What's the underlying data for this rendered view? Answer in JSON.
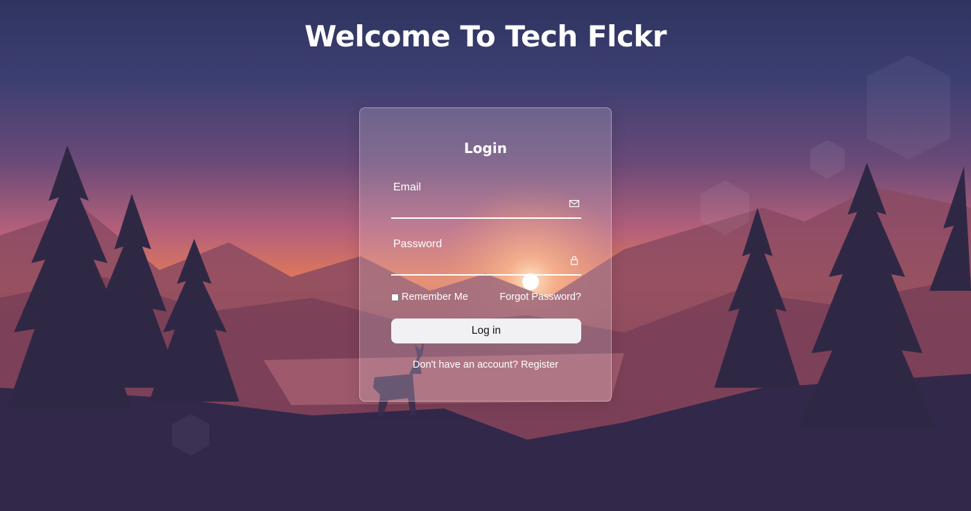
{
  "page": {
    "title": "Welcome To Tech Flckr"
  },
  "login_card": {
    "title": "Login",
    "email": {
      "label": "Email",
      "value": "",
      "icon": "mail-icon"
    },
    "password": {
      "label": "Password",
      "value": "",
      "icon": "lock-icon"
    },
    "remember_me": {
      "label": "Remember Me",
      "checked": false
    },
    "forgot_password": "Forgot Password?",
    "submit_label": "Log in",
    "register_prompt": "Don't have an account?",
    "register_link": "Register"
  },
  "colors": {
    "sky_top": "#363a6a",
    "sunset_glow": "#e9844f",
    "mountain": "#6b3a5a",
    "trees": "#2f2845",
    "button_bg": "#f1f1f3"
  }
}
